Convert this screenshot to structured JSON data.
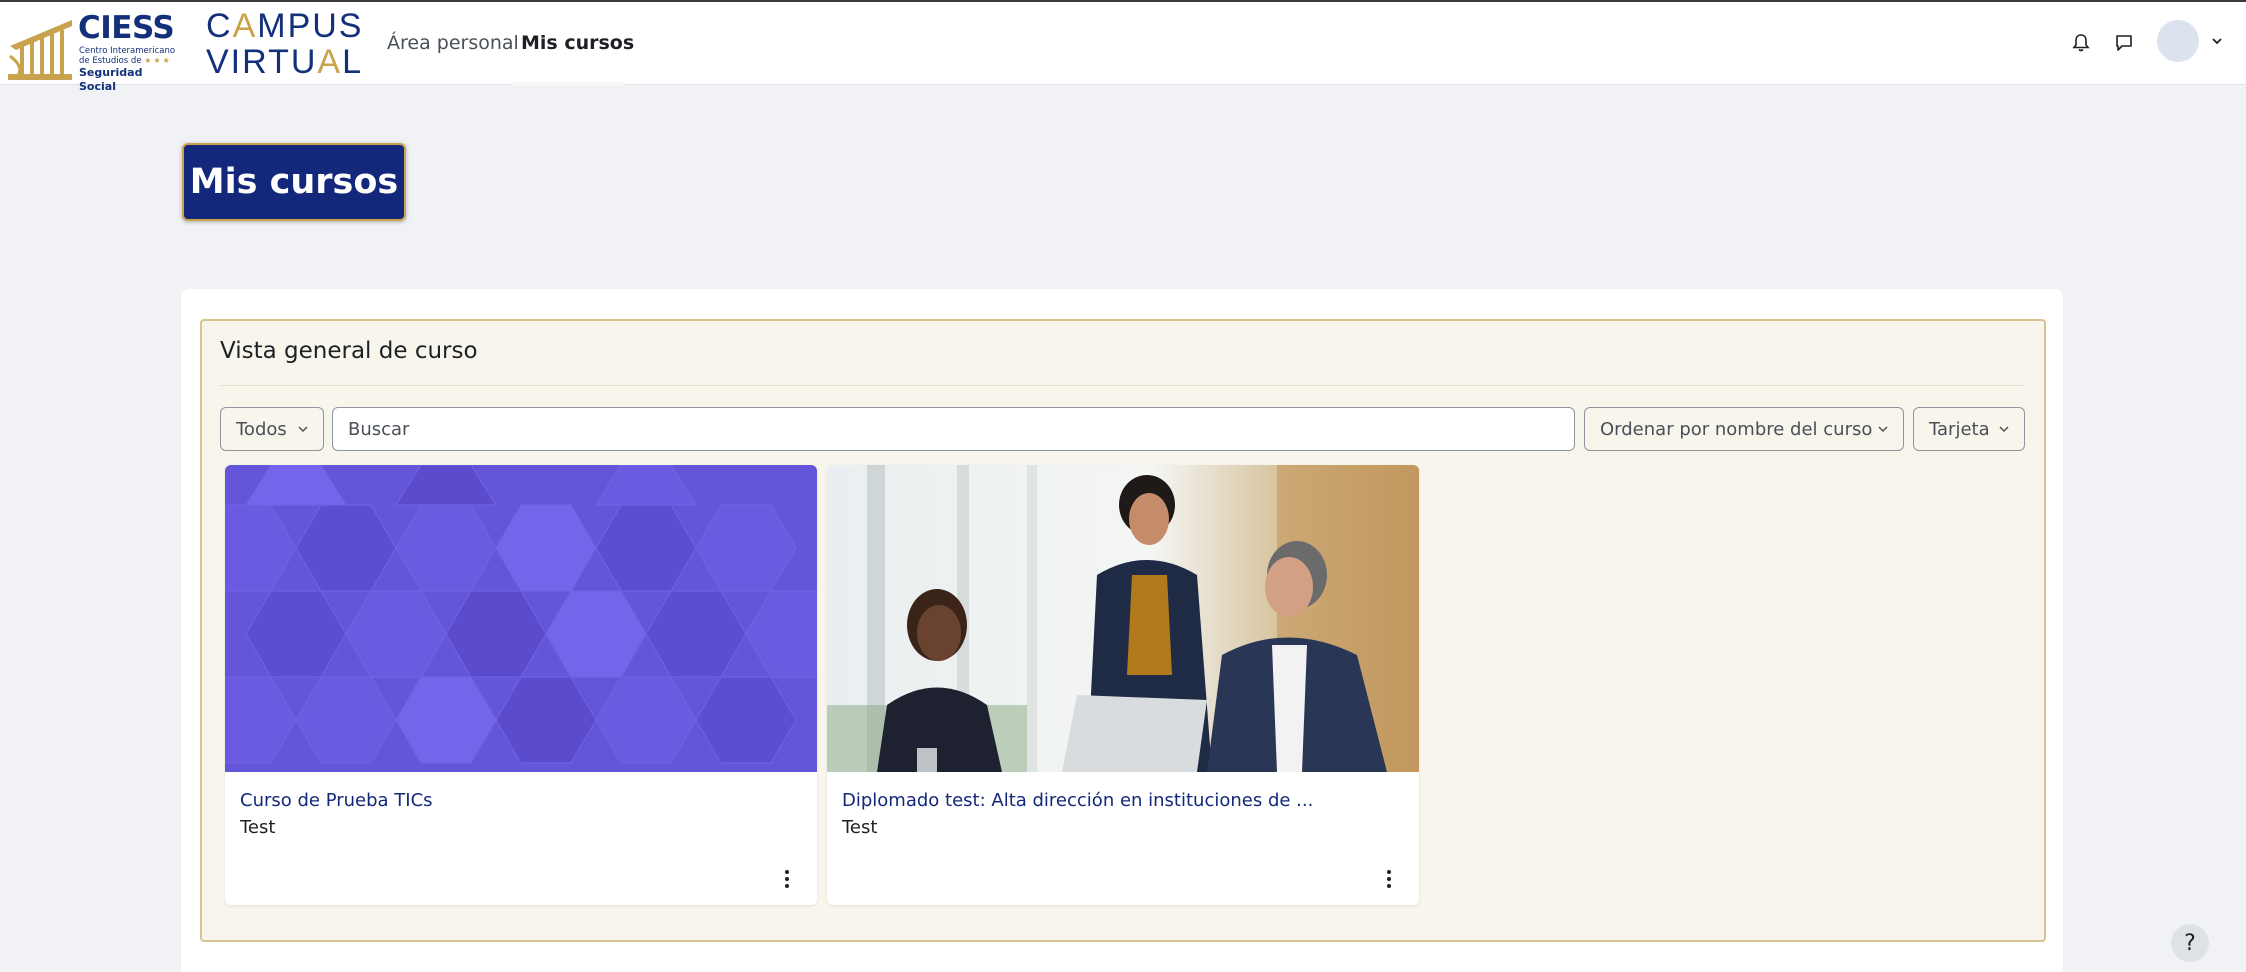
{
  "header": {
    "logo_ciess": {
      "name": "CIESS",
      "line1": "Centro Interamericano",
      "line2": "de Estudios de",
      "line3": "Seguridad Social"
    },
    "logo_campus": {
      "line1": "CAMPUS",
      "line2": "VIRTUAL"
    },
    "nav": [
      {
        "label": "Área personal",
        "active": false
      },
      {
        "label": "Mis cursos",
        "active": true
      }
    ],
    "icons": [
      "bell-icon",
      "chat-icon",
      "avatar",
      "chevron-down-icon"
    ]
  },
  "page": {
    "title": "Mis cursos"
  },
  "overview": {
    "title": "Vista general de curso",
    "filter_label": "Todos",
    "search_placeholder": "Buscar",
    "sort_label": "Ordenar por nombre del curso",
    "view_label": "Tarjeta",
    "courses": [
      {
        "name": "Curso de Prueba TICs",
        "category": "Test",
        "image": "purple-hexagon-pattern"
      },
      {
        "name": "Diplomado test: Alta dirección en instituciones de ...",
        "category": "Test",
        "image": "business-meeting-photo"
      }
    ]
  },
  "help": {
    "label": "?"
  },
  "colors": {
    "brand_navy": "#13287a",
    "brand_gold": "#c9a24d",
    "block_bg": "#f8f5ec",
    "hex_purple": "#6a5ce0"
  }
}
